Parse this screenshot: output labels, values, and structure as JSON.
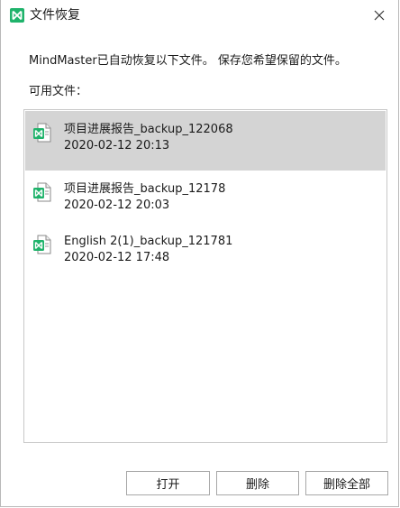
{
  "window": {
    "title": "文件恢复",
    "close_glyph": "✕"
  },
  "message": "MindMaster已自动恢复以下文件。 保存您希望保留的文件。",
  "list_label": "可用文件：",
  "files": [
    {
      "name": "项目进展报告_backup_122068",
      "date": "2020-02-12 20:13",
      "selected": true
    },
    {
      "name": "项目进展报告_backup_12178",
      "date": "2020-02-12 20:03",
      "selected": false
    },
    {
      "name": "English 2(1)_backup_121781",
      "date": "2020-02-12 17:48",
      "selected": false
    }
  ],
  "buttons": {
    "open": "打开",
    "delete": "删除",
    "delete_all": "删除全部"
  },
  "colors": {
    "brand_green": "#1fb36b",
    "selected_bg": "#d4d4d4"
  }
}
